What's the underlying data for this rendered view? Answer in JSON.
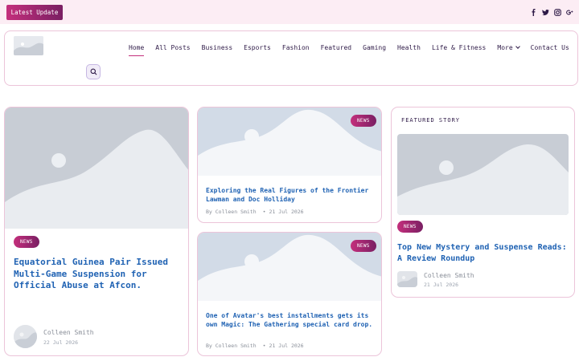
{
  "topbar": {
    "latest_label": "Latest Update",
    "social": [
      "facebook-icon",
      "twitter-icon",
      "instagram-icon",
      "google-plus-icon"
    ]
  },
  "nav": {
    "items": [
      "Home",
      "All Posts",
      "Business",
      "Esports",
      "Fashion",
      "Featured",
      "Gaming",
      "Health",
      "Life & Fitness",
      "More",
      "Contact Us"
    ]
  },
  "colors": {
    "accent": "#c42f7c",
    "accent_dark": "#7a1f63",
    "link": "#1f62b3",
    "border": "#ecc4d9"
  },
  "main_story": {
    "badge": "NEWS",
    "title": "Equatorial Guinea Pair Issued Multi-Game Suspension for Official Abuse at Afcon.",
    "author": "Colleen Smith",
    "date": "22 Jul 2026"
  },
  "middle_stories": [
    {
      "badge": "NEWS",
      "title": "Exploring the Real Figures of the Frontier Lawman and Doc Holliday",
      "byline": "By Colleen Smith",
      "date": "21 Jul 2026"
    },
    {
      "badge": "NEWS",
      "title": "One of Avatar's best installments gets its own Magic: The Gathering special card drop.",
      "byline": "By Colleen Smith",
      "date": "21 Jul 2026"
    }
  ],
  "featured": {
    "label": "FEATURED STORY",
    "badge": "NEWS",
    "title": "Top New Mystery and Suspense Reads: A Review Roundup",
    "author": "Colleen Smith",
    "date": "21 Jul 2026"
  }
}
